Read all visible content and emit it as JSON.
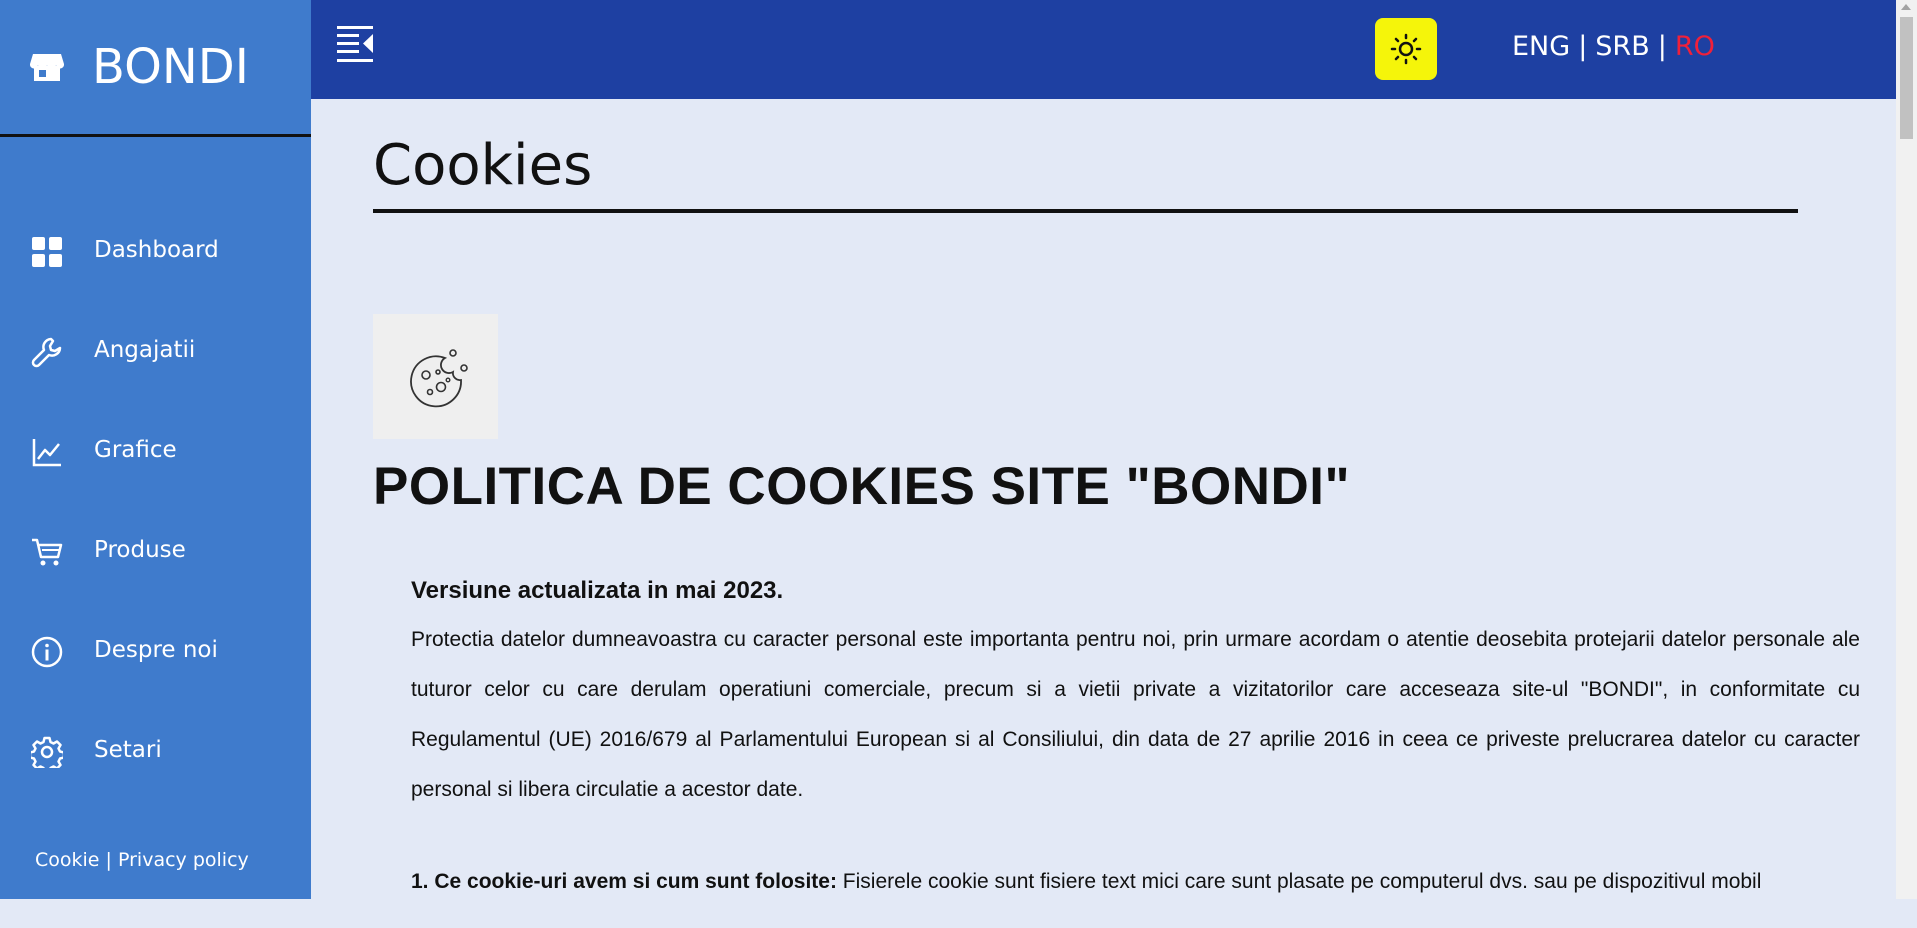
{
  "sidebar": {
    "brand": "BONDI",
    "items": [
      {
        "label": "Dashboard",
        "icon": "grid-icon"
      },
      {
        "label": "Angajatii",
        "icon": "wrench-icon"
      },
      {
        "label": "Grafice",
        "icon": "line-chart-icon"
      },
      {
        "label": "Produse",
        "icon": "cart-icon"
      },
      {
        "label": "Despre noi",
        "icon": "info-icon"
      },
      {
        "label": "Setari",
        "icon": "gear-icon"
      }
    ],
    "footer": {
      "cookie": "Cookie",
      "separator": "|",
      "privacy": "Privacy policy"
    }
  },
  "topbar": {
    "languages": [
      "ENG",
      "SRB",
      "RO"
    ],
    "active_language": "RO",
    "separator": "|"
  },
  "main": {
    "title": "Cookies",
    "heading": "POLITICA DE COOKIES SITE \"BONDI\"",
    "version": "Versiune actualizata in mai 2023.",
    "paragraph": "Protectia datelor dumneavoastra cu caracter personal este importanta pentru noi, prin urmare acordam o atentie deosebita protejarii datelor personale ale tuturor celor cu care derulam operatiuni comerciale, precum si a vietii private a vizitatorilor care acceseaza site-ul \"BONDI\", in conformitate cu Regulamentul (UE) 2016/679 al Parlamentului European si al Consiliului, din data de 27 aprilie 2016 in ceea ce priveste prelucrarea datelor cu caracter personal si libera circulatie a acestor date.",
    "section1_title": "1. Ce cookie-uri avem si cum sunt folosite:",
    "section1_text": "Fisierele cookie sunt fisiere text mici care sunt plasate pe computerul dvs. sau pe dispozitivul mobil"
  },
  "colors": {
    "sidebar": "#3f7bcc",
    "topbar": "#1e40a2",
    "background": "#e3e9f6",
    "theme_button": "#f5f50a",
    "active_language": "#f0203a"
  }
}
